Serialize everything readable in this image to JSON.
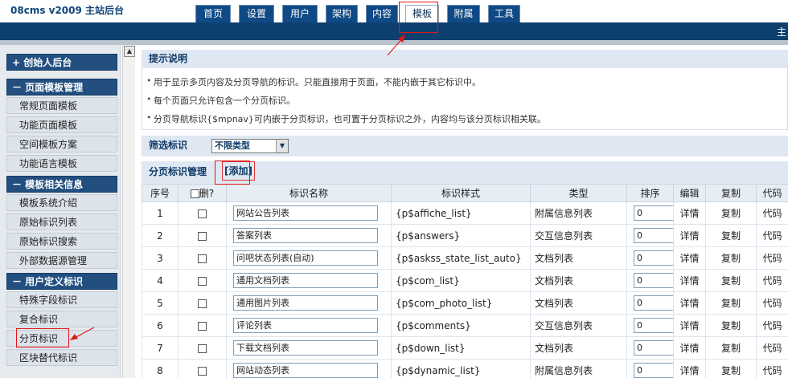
{
  "app": {
    "brand": "08cms  v2009  主站后台"
  },
  "tabs": [
    {
      "label": "首页",
      "active": false
    },
    {
      "label": "设置",
      "active": false
    },
    {
      "label": "用户",
      "active": false
    },
    {
      "label": "架构",
      "active": false
    },
    {
      "label": "内容",
      "active": false
    },
    {
      "label": "模板",
      "active": true
    },
    {
      "label": "附属",
      "active": false
    },
    {
      "label": "工具",
      "active": false
    }
  ],
  "topbar": {
    "right_text": "主"
  },
  "sidebar": {
    "founder": "+  创始人后台",
    "section1": "－  页面模板管理",
    "section1_items": [
      "常规页面模板",
      "功能页面模板",
      "空间模板方案",
      "功能语言模板"
    ],
    "section2": "－  模板相关信息",
    "section2_items": [
      "模板系统介绍",
      "原始标识列表",
      "原始标识搜索",
      "外部数据源管理"
    ],
    "section3": "－  用户定义标识",
    "section3_items": [
      "特殊字段标识",
      "复合标识",
      "分页标识",
      "区块替代标识"
    ]
  },
  "tips": {
    "title": "提示说明",
    "items": [
      "用于显示多页内容及分页导航的标识。只能直接用于页面，不能内嵌于其它标识中。",
      "每个页面只允许包含一个分页标识。",
      "分页导航标识{$mpnav}可内嵌于分页标识，也可置于分页标识之外，内容均与该分页标识相关联。"
    ]
  },
  "filter": {
    "label": "筛选标识",
    "value": "不限类型"
  },
  "manage": {
    "title": "分页标识管理",
    "add_label": "[添加]"
  },
  "table": {
    "headers": [
      "序号",
      "删?",
      "标识名称",
      "标识样式",
      "类型",
      "排序",
      "编辑",
      "复制",
      "代码"
    ],
    "rows": [
      {
        "no": "1",
        "name": "网站公告列表",
        "style": "{p$affiche_list}",
        "type": "附属信息列表",
        "order": "0",
        "edit": "详情",
        "copy": "复制",
        "code": "代码"
      },
      {
        "no": "2",
        "name": "答案列表",
        "style": "{p$answers}",
        "type": "交互信息列表",
        "order": "0",
        "edit": "详情",
        "copy": "复制",
        "code": "代码"
      },
      {
        "no": "3",
        "name": "问吧状态列表(自动)",
        "style": "{p$askss_state_list_auto}",
        "type": "文档列表",
        "order": "0",
        "edit": "详情",
        "copy": "复制",
        "code": "代码"
      },
      {
        "no": "4",
        "name": "通用文档列表",
        "style": "{p$com_list}",
        "type": "文档列表",
        "order": "0",
        "edit": "详情",
        "copy": "复制",
        "code": "代码"
      },
      {
        "no": "5",
        "name": "通用图片列表",
        "style": "{p$com_photo_list}",
        "type": "文档列表",
        "order": "0",
        "edit": "详情",
        "copy": "复制",
        "code": "代码"
      },
      {
        "no": "6",
        "name": "评论列表",
        "style": "{p$comments}",
        "type": "交互信息列表",
        "order": "0",
        "edit": "详情",
        "copy": "复制",
        "code": "代码"
      },
      {
        "no": "7",
        "name": "下载文档列表",
        "style": "{p$down_list}",
        "type": "文档列表",
        "order": "0",
        "edit": "详情",
        "copy": "复制",
        "code": "代码"
      },
      {
        "no": "8",
        "name": "网站动态列表",
        "style": "{p$dynamic_list}",
        "type": "附属信息列表",
        "order": "0",
        "edit": "详情",
        "copy": "复制",
        "code": "代码"
      }
    ]
  },
  "colors": {
    "nav_blue": "#0f4a86",
    "annotation_red": "#e01515"
  }
}
